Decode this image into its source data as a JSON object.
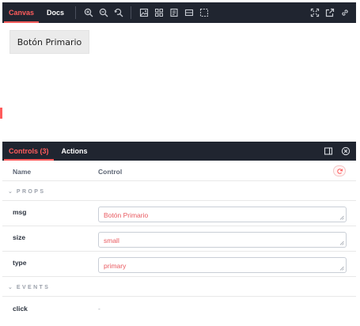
{
  "toolbar": {
    "tabs": [
      {
        "label": "Canvas",
        "active": true
      },
      {
        "label": "Docs",
        "active": false
      }
    ],
    "tools": [
      "zoom-in-icon",
      "zoom-out-icon",
      "zoom-reset-icon",
      "background-icon",
      "grid-icon",
      "measure-icon",
      "outline-icon",
      "viewport-icon"
    ],
    "right_tools": [
      "fullscreen-icon",
      "open-new-tab-icon",
      "copy-link-icon"
    ]
  },
  "canvas": {
    "button_label": "Botón Primario"
  },
  "panel": {
    "tabs": [
      {
        "label": "Controls (3)",
        "active": true
      },
      {
        "label": "Actions",
        "active": false
      }
    ],
    "right_tools": [
      "sidebar-toggle-icon",
      "close-icon"
    ]
  },
  "table": {
    "header": {
      "name": "Name",
      "control": "Control"
    },
    "sections": {
      "props": "PROPS",
      "events": "EVENTS"
    },
    "props": [
      {
        "name": "msg",
        "value": "Botón Primario"
      },
      {
        "name": "size",
        "value": "small"
      },
      {
        "name": "type",
        "value": "primary"
      }
    ],
    "events": [
      {
        "name": "click",
        "value": "-"
      }
    ]
  },
  "colors": {
    "accent": "#ff5c5c",
    "toolbar_bg": "#202530"
  }
}
